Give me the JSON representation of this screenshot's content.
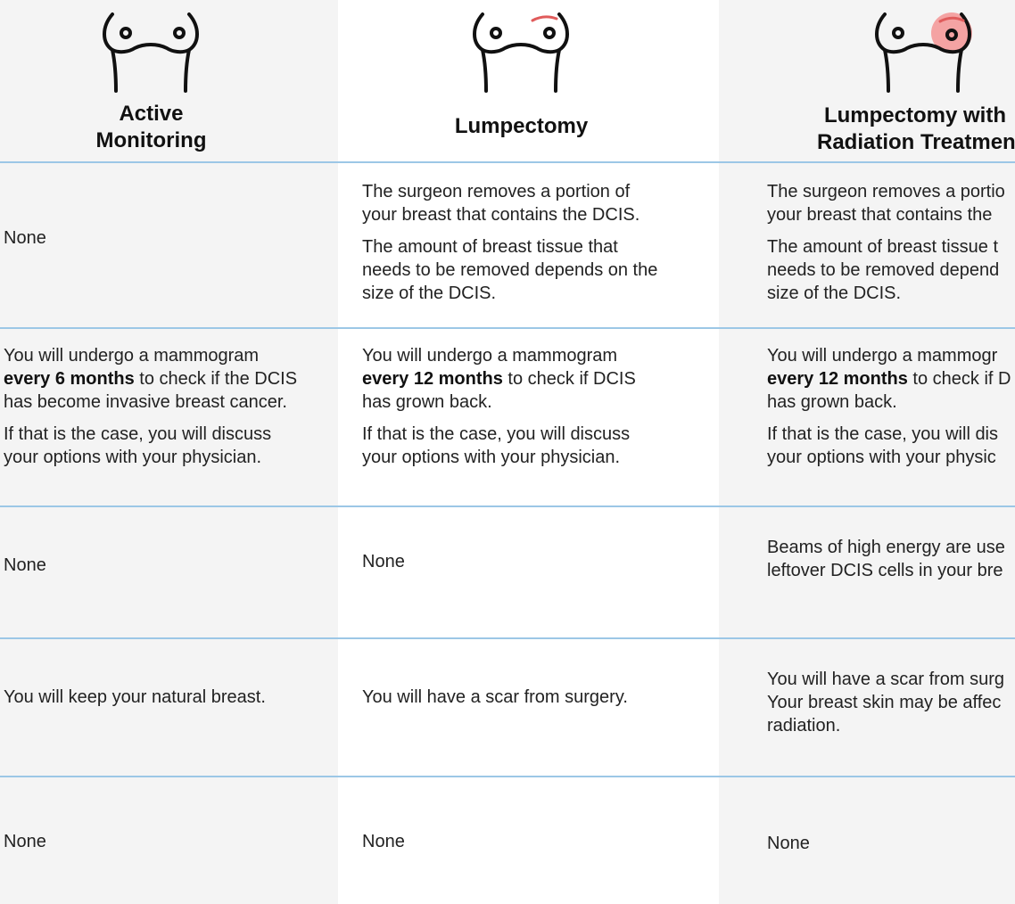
{
  "columns": [
    {
      "title": "Active\nMonitoring",
      "icon": "breasts-icon"
    },
    {
      "title": "Lumpectomy",
      "icon": "breasts-incision-icon"
    },
    {
      "title": "Lumpectomy with\nRadiation Treatmen",
      "icon": "breasts-radiation-icon"
    }
  ],
  "accent_colors": {
    "divider": "#9cc7e6",
    "incision": "#e05b5b",
    "radiation": "#f4a3a3"
  },
  "rows": [
    {
      "c1": {
        "p1": "None"
      },
      "c2": {
        "p1": "The surgeon removes a portion of\nyour breast that contains the DCIS.",
        "p2": "The amount of breast tissue that\nneeds to be removed depends on the\nsize of the DCIS."
      },
      "c3": {
        "p1": "The surgeon removes a portio\nyour breast that contains the",
        "p2": "The amount of breast tissue t\nneeds to be removed depend\nsize of the DCIS."
      }
    },
    {
      "c1": {
        "pre": "You will undergo a mammogram",
        "bold": "every 6 months",
        "post": " to check if the DCIS",
        "rest": "has become invasive breast cancer.",
        "p2": "If that is the case, you will discuss\nyour options with your physician."
      },
      "c2": {
        "pre": "You will undergo a mammogram",
        "bold": "every 12 months",
        "post": " to check if DCIS",
        "rest": "has grown back.",
        "p2": "If that is the case, you will discuss\nyour options with your physician."
      },
      "c3": {
        "pre": "You will undergo a mammogr",
        "bold": "every 12 months",
        "post": " to check if D",
        "rest": "has grown back.",
        "p2": "If that is the case, you will dis\nyour options with your physic"
      }
    },
    {
      "c1": {
        "p1": "None"
      },
      "c2": {
        "p1": "None"
      },
      "c3": {
        "p1": "Beams of high energy are use\nleftover DCIS cells in your bre"
      }
    },
    {
      "c1": {
        "p1": "You will keep your natural breast."
      },
      "c2": {
        "p1": "You will have a scar from surgery."
      },
      "c3": {
        "p1": "You will have a scar from surg\nYour breast skin may be affec\nradiation."
      }
    },
    {
      "c1": {
        "p1": "None"
      },
      "c2": {
        "p1": "None"
      },
      "c3": {
        "p1": "None"
      }
    }
  ]
}
